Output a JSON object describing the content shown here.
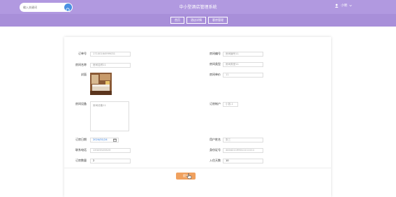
{
  "header": {
    "search_placeholder": "输入关键词",
    "title": "中小型酒店管理系统",
    "user_label": "小明"
  },
  "nav": [
    "首页",
    "酒店详情",
    "客房管理"
  ],
  "form": {
    "left": [
      {
        "label": "订单号",
        "value": "17100164999031"
      },
      {
        "label": "房间名称",
        "value": "房间名称11"
      },
      {
        "label": "封面",
        "value": ""
      },
      {
        "label": "房间设备",
        "value": "房间设备11"
      },
      {
        "label": "订房日期",
        "value": "2024/01/24"
      },
      {
        "label": "联系电话",
        "value": "13323323323"
      },
      {
        "label": "订房数量",
        "value": "2"
      }
    ],
    "right": [
      {
        "label": "房间编号",
        "value": "房间编号11"
      },
      {
        "label": "房间类型",
        "value": "房间类型11"
      },
      {
        "label": "房间单价",
        "value": "11"
      },
      {
        "label": "订房帐户",
        "value": "小张-1"
      },
      {
        "label": "用户姓名",
        "value": "张三"
      },
      {
        "label": "身份证号",
        "value": "440421199011111111"
      },
      {
        "label": "入住天数",
        "value": "10"
      }
    ],
    "submit_label": "提交"
  },
  "icons": {
    "search": "search-icon",
    "user_avatar": "user-icon",
    "dropdown": "chevron-down-icon",
    "calendar": "calendar-icon",
    "cursor": "pointer-hand-icon"
  },
  "colors": {
    "header_bg": "#b199e0",
    "nav_bg": "#a88fd9",
    "search_button": "#4a90e2",
    "submit_button": "#f0a15f"
  }
}
